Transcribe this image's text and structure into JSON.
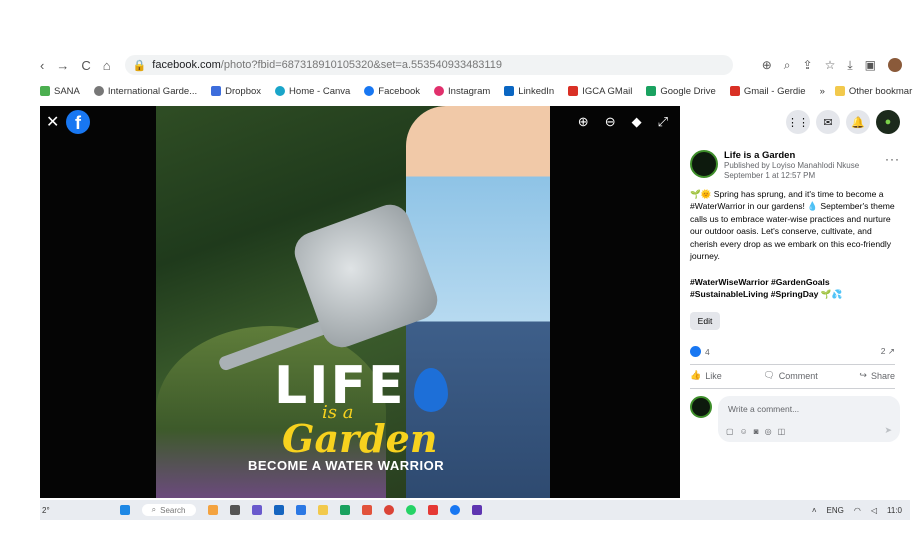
{
  "browser": {
    "url_host": "facebook.com",
    "url_path": "/photo?fbid=687318910105320&set=a.553540933483119",
    "nav": {
      "back": "‹",
      "forward": "→",
      "reload": "C",
      "home": "⌂"
    }
  },
  "bookmarks": {
    "items": [
      {
        "label": "SANA",
        "color": "#4caf50"
      },
      {
        "label": "International Garde...",
        "color": "#777777"
      },
      {
        "label": "Dropbox",
        "color": "#3d6ddc"
      },
      {
        "label": "Home - Canva",
        "color": "#1aa5c9"
      },
      {
        "label": "Facebook",
        "color": "#1877f2"
      },
      {
        "label": "Instagram",
        "color": "#e1306c"
      },
      {
        "label": "LinkedIn",
        "color": "#0a66c2"
      },
      {
        "label": "IGCA GMail",
        "color": "#d93025"
      },
      {
        "label": "Google Drive",
        "color": "#1aa260"
      },
      {
        "label": "Gmail - Gerdie",
        "color": "#d93025"
      }
    ],
    "overflow": "»",
    "other": "Other bookmar"
  },
  "photo": {
    "close": "✕",
    "fb_logo": "f",
    "brand_life": "LIFE",
    "brand_isa": "is a",
    "brand_garden": "Garden",
    "brand_tagline": "BECOME A WATER WARRIOR"
  },
  "post": {
    "page_name": "Life is a Garden",
    "published_by": "Published by Loyiso Manahlodi Nkuse",
    "date": "September 1 at 12:57 PM",
    "more": "···",
    "body": "🌱🌞 Spring has sprung, and it's time to become a #WaterWarrior in our gardens! 💧 September's theme calls us to embrace water-wise practices and nurture our outdoor oasis. Let's conserve, cultivate, and cherish every drop as we embark on this eco-friendly journey.",
    "hashtags": "#WaterWiseWarrior #GardenGoals #SustainableLiving #SpringDay 🌱💦",
    "edit_label": "Edit",
    "reaction_count": "4",
    "share_count": "2",
    "like_label": "Like",
    "comment_label": "Comment",
    "share_label": "Share",
    "comment_placeholder": "Write a comment..."
  },
  "taskbar": {
    "search": "Search",
    "lang": "ENG",
    "time": "11:0",
    "left": "2°"
  }
}
